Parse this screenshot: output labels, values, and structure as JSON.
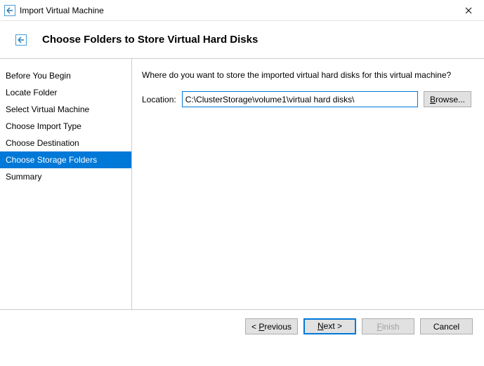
{
  "titlebar": {
    "title": "Import Virtual Machine"
  },
  "header": {
    "title": "Choose Folders to Store Virtual Hard Disks"
  },
  "sidebar": {
    "items": [
      {
        "label": "Before You Begin",
        "selected": false
      },
      {
        "label": "Locate Folder",
        "selected": false
      },
      {
        "label": "Select Virtual Machine",
        "selected": false
      },
      {
        "label": "Choose Import Type",
        "selected": false
      },
      {
        "label": "Choose Destination",
        "selected": false
      },
      {
        "label": "Choose Storage Folders",
        "selected": true
      },
      {
        "label": "Summary",
        "selected": false
      }
    ]
  },
  "content": {
    "prompt": "Where do you want to store the imported virtual hard disks for this virtual machine?",
    "location_label": "Location:",
    "location_value": "C:\\ClusterStorage\\volume1\\virtual hard disks\\",
    "browse_first": "B",
    "browse_rest": "rowse..."
  },
  "footer": {
    "previous_prefix": "< ",
    "previous_first": "P",
    "previous_rest": "revious",
    "next_first": "N",
    "next_rest": "ext >",
    "finish_first": "F",
    "finish_rest": "inish",
    "cancel": "Cancel"
  }
}
